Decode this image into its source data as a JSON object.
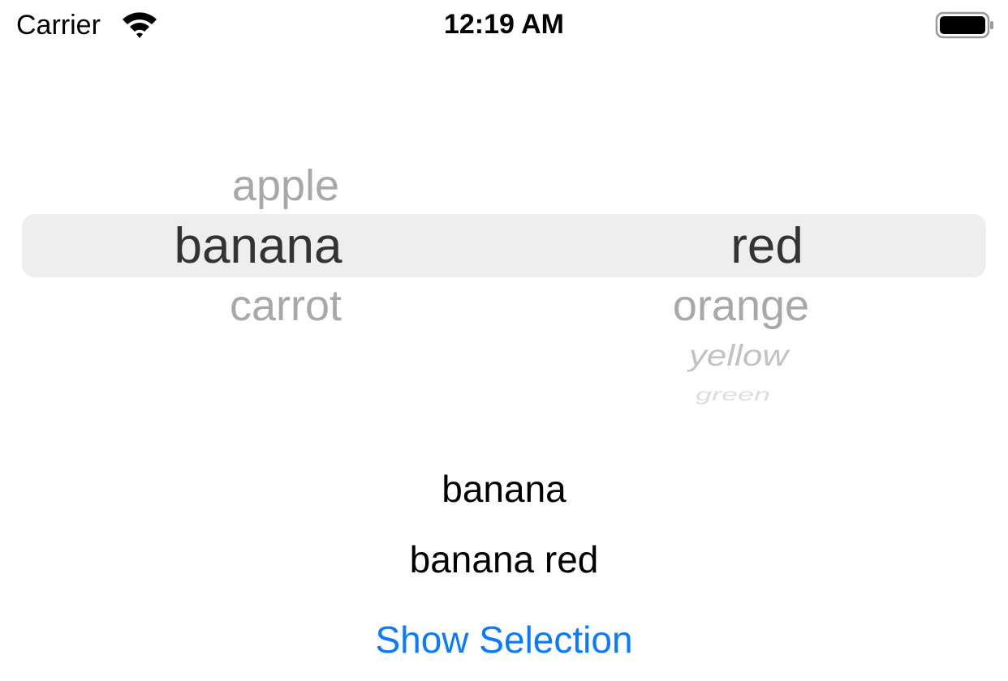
{
  "status_bar": {
    "carrier": "Carrier",
    "time": "12:19 AM",
    "icons": [
      "wifi-icon",
      "battery-icon"
    ]
  },
  "picker": {
    "column1": {
      "items": [
        "apple",
        "banana",
        "carrot"
      ],
      "selected": "banana"
    },
    "column2": {
      "items": [
        "red",
        "orange",
        "yellow",
        "green"
      ],
      "selected": "red"
    }
  },
  "labels": {
    "selection": "banana",
    "combined": "banana red"
  },
  "button": {
    "label": "Show Selection",
    "color": "#0a7aff"
  }
}
